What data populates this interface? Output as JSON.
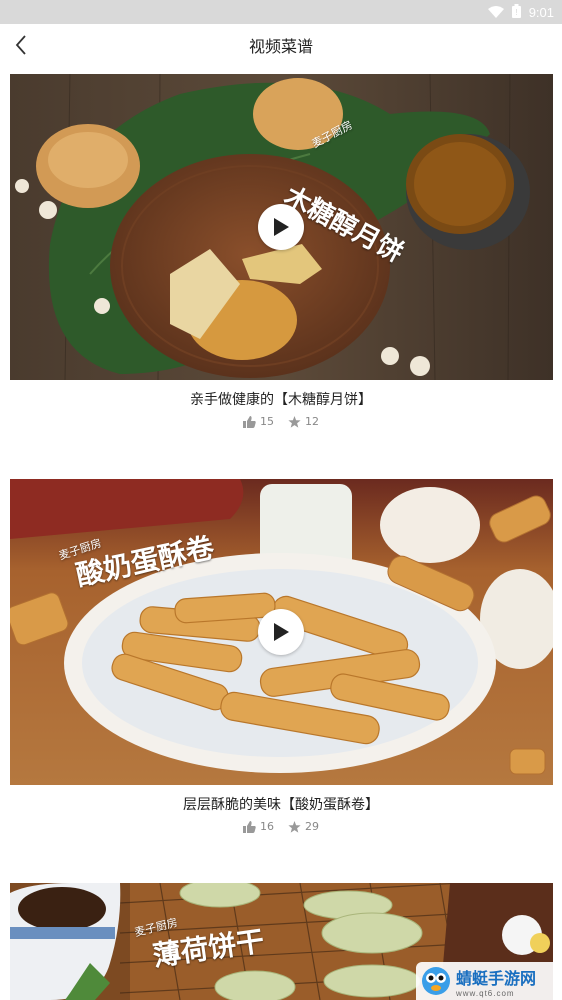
{
  "status_bar": {
    "time": "9:01"
  },
  "header": {
    "title": "视频菜谱"
  },
  "recipes": [
    {
      "overlay_brand": "麦子厨房",
      "overlay_title": "木糖醇月饼",
      "caption": "亲手做健康的【木糖醇月饼】",
      "likes": "15",
      "favorites": "12"
    },
    {
      "overlay_brand": "麦子厨房",
      "overlay_title": "酸奶蛋酥卷",
      "caption": "层层酥脆的美味【酸奶蛋酥卷】",
      "likes": "16",
      "favorites": "29"
    },
    {
      "overlay_brand": "麦子厨房",
      "overlay_title": "薄荷饼干"
    }
  ],
  "watermark": {
    "main": "蜻蜓手游网",
    "sub": "www.qt6.com"
  },
  "colors": {
    "status_bar": "#d9d9d9",
    "text": "#222222",
    "stat_text": "#888888"
  }
}
